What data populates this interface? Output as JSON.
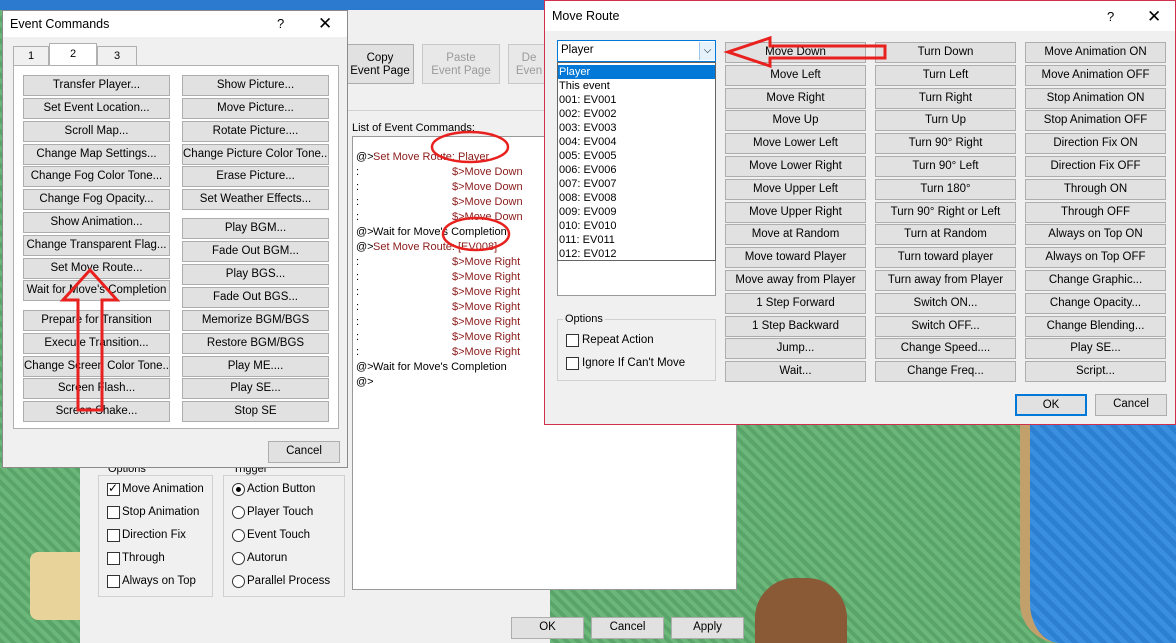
{
  "event_commands": {
    "title": "Event Commands",
    "help": "?",
    "close": "✕",
    "tabs": [
      "1",
      "2",
      "3"
    ],
    "col1": [
      "Transfer Player...",
      "Set Event Location...",
      "Scroll Map...",
      "Change Map Settings...",
      "Change Fog Color Tone...",
      "Change Fog Opacity...",
      "Show Animation...",
      "Change Transparent Flag...",
      "Set Move Route...",
      "Wait for Move's Completion",
      "Prepare for Transition",
      "Execute Transition...",
      "Change Screen Color Tone...",
      "Screen Flash...",
      "Screen Shake..."
    ],
    "col2a": [
      "Show Picture...",
      "Move Picture...",
      "Rotate Picture....",
      "Change Picture Color Tone...",
      "Erase Picture...",
      "Set Weather Effects..."
    ],
    "col2b": [
      "Play BGM...",
      "Fade Out BGM...",
      "Play BGS...",
      "Fade Out BGS...",
      "Memorize BGM/BGS",
      "Restore BGM/BGS",
      "Play ME....",
      "Play SE...",
      "Stop SE"
    ],
    "cancel": "Cancel"
  },
  "event_page": {
    "copy_label": "Copy\nEvent Page",
    "paste_label": "Paste\nEvent Page",
    "delete_label": "De\nEven",
    "list_label": "List of Event Commands:",
    "options_label": "Options",
    "options": [
      {
        "label": "Move Animation",
        "checked": true
      },
      {
        "label": "Stop Animation",
        "checked": false
      },
      {
        "label": "Direction Fix",
        "checked": false
      },
      {
        "label": "Through",
        "checked": false
      },
      {
        "label": "Always on Top",
        "checked": false
      }
    ],
    "trigger_label": "Trigger",
    "triggers": [
      {
        "label": "Action Button",
        "selected": true
      },
      {
        "label": "Player Touch",
        "selected": false
      },
      {
        "label": "Event Touch",
        "selected": false
      },
      {
        "label": "Autorun",
        "selected": false
      },
      {
        "label": "Parallel Process",
        "selected": false
      }
    ],
    "ok": "OK",
    "cancel": "Cancel",
    "apply": "Apply",
    "commands": [
      {
        "prefix": "@>",
        "text": "Set Move Route: Player",
        "color": "#8b1a1a"
      },
      {
        "prefix": " :",
        "text": "$>Move Down",
        "color": "#8b1a1a",
        "indent": true
      },
      {
        "prefix": " :",
        "text": "$>Move Down",
        "color": "#8b1a1a",
        "indent": true
      },
      {
        "prefix": " :",
        "text": "$>Move Down",
        "color": "#8b1a1a",
        "indent": true
      },
      {
        "prefix": " :",
        "text": "$>Move Down",
        "color": "#8b1a1a",
        "indent": true
      },
      {
        "prefix": "@>",
        "text": "Wait for Move's Completion",
        "color": "#000000"
      },
      {
        "prefix": "@>",
        "text": "Set Move Route: [EV008]",
        "color": "#8b1a1a"
      },
      {
        "prefix": " :",
        "text": "$>Move Right",
        "color": "#8b1a1a",
        "indent": true
      },
      {
        "prefix": " :",
        "text": "$>Move Right",
        "color": "#8b1a1a",
        "indent": true
      },
      {
        "prefix": " :",
        "text": "$>Move Right",
        "color": "#8b1a1a",
        "indent": true
      },
      {
        "prefix": " :",
        "text": "$>Move Right",
        "color": "#8b1a1a",
        "indent": true
      },
      {
        "prefix": " :",
        "text": "$>Move Right",
        "color": "#8b1a1a",
        "indent": true
      },
      {
        "prefix": " :",
        "text": "$>Move Right",
        "color": "#8b1a1a",
        "indent": true
      },
      {
        "prefix": " :",
        "text": "$>Move Right",
        "color": "#8b1a1a",
        "indent": true
      },
      {
        "prefix": "@>",
        "text": "Wait for Move's Completion",
        "color": "#000000"
      },
      {
        "prefix": "@>",
        "text": "",
        "color": "#000000"
      }
    ]
  },
  "move_route": {
    "title": "Move Route",
    "help": "?",
    "close": "✕",
    "target_selected": "Player",
    "target_options": [
      "Player",
      "This event",
      "001: EV001",
      "002: EV002",
      "003: EV003",
      "004: EV004",
      "005: EV005",
      "006: EV006",
      "007: EV007",
      "008: EV008",
      "009: EV009",
      "010: EV010",
      "011: EV011",
      "012: EV012"
    ],
    "options_label": "Options",
    "repeat_action": "Repeat Action",
    "ignore_if_cant_move": "Ignore If Can't Move",
    "col1": [
      "Move Down",
      "Move Left",
      "Move Right",
      "Move Up",
      "Move Lower Left",
      "Move Lower Right",
      "Move Upper Left",
      "Move Upper Right",
      "Move at Random",
      "Move toward Player",
      "Move away from Player",
      "1 Step Forward",
      "1 Step Backward",
      "Jump...",
      "Wait..."
    ],
    "col2": [
      "Turn Down",
      "Turn Left",
      "Turn Right",
      "Turn Up",
      "Turn 90° Right",
      "Turn 90° Left",
      "Turn 180°",
      "Turn 90° Right or Left",
      "Turn at Random",
      "Turn toward player",
      "Turn away from Player",
      "Switch ON...",
      "Switch OFF...",
      "Change Speed....",
      "Change Freq..."
    ],
    "col3": [
      "Move Animation ON",
      "Move Animation OFF",
      "Stop Animation ON",
      "Stop Animation OFF",
      "Direction Fix ON",
      "Direction Fix OFF",
      "Through ON",
      "Through OFF",
      "Always on Top ON",
      "Always on Top OFF",
      "Change Graphic...",
      "Change Opacity...",
      "Change Blending...",
      "Play SE...",
      "Script..."
    ],
    "ok": "OK",
    "cancel": "Cancel"
  },
  "colors": {
    "annotation": "#e8211f",
    "selection": "#0078d7",
    "command_red": "#8b1a1a"
  }
}
